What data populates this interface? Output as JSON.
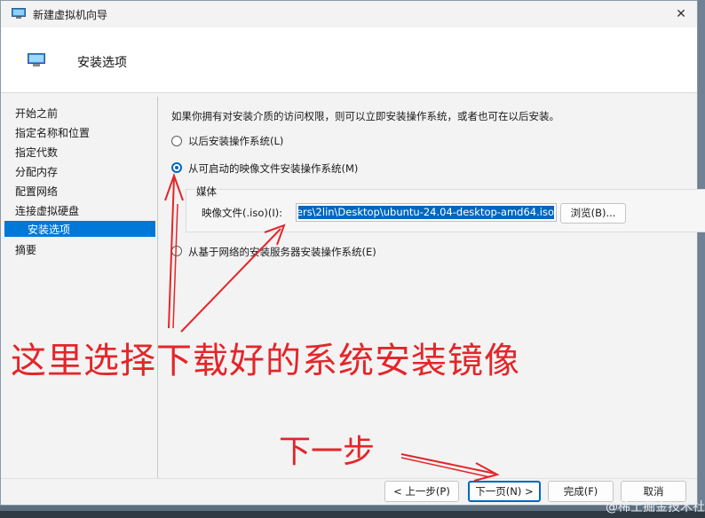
{
  "window": {
    "title": "新建虚拟机向导",
    "close_glyph": "✕"
  },
  "header": {
    "title": "安装选项"
  },
  "sidebar": {
    "items": [
      {
        "label": "开始之前"
      },
      {
        "label": "指定名称和位置"
      },
      {
        "label": "指定代数"
      },
      {
        "label": "分配内存"
      },
      {
        "label": "配置网络"
      },
      {
        "label": "连接虚拟硬盘"
      },
      {
        "label": "安装选项",
        "selected": true
      },
      {
        "label": "摘要"
      }
    ]
  },
  "content": {
    "description": "如果你拥有对安装介质的访问权限，则可以立即安装操作系统，或者也可在以后安装。",
    "options": [
      {
        "label": "以后安装操作系统(L)",
        "checked": false
      },
      {
        "label": "从可启动的映像文件安装操作系统(M)",
        "checked": true
      },
      {
        "label": "从基于网络的安装服务器安装操作系统(E)",
        "checked": false
      }
    ],
    "media": {
      "group_title": "媒体",
      "field_label": "映像文件(.iso)(I):",
      "field_value": "ers\\2lin\\Desktop\\ubuntu-24.04-desktop-amd64.iso",
      "browse_label": "浏览(B)..."
    }
  },
  "footer": {
    "prev_label": "< 上一步(P)",
    "next_label": "下一页(N) >",
    "finish_label": "完成(F)",
    "cancel_label": "取消"
  },
  "annotations": {
    "main_text": "这里选择下载好的系统安装镜像",
    "next_text": "下一步",
    "color": "#e3262a"
  },
  "watermark": "@稀土掘金技术社区",
  "colors": {
    "accent": "#0067c0",
    "selected_nav": "#0078d7"
  },
  "icons": [
    "vm-wizard-icon",
    "close-icon",
    "install-options-icon"
  ]
}
